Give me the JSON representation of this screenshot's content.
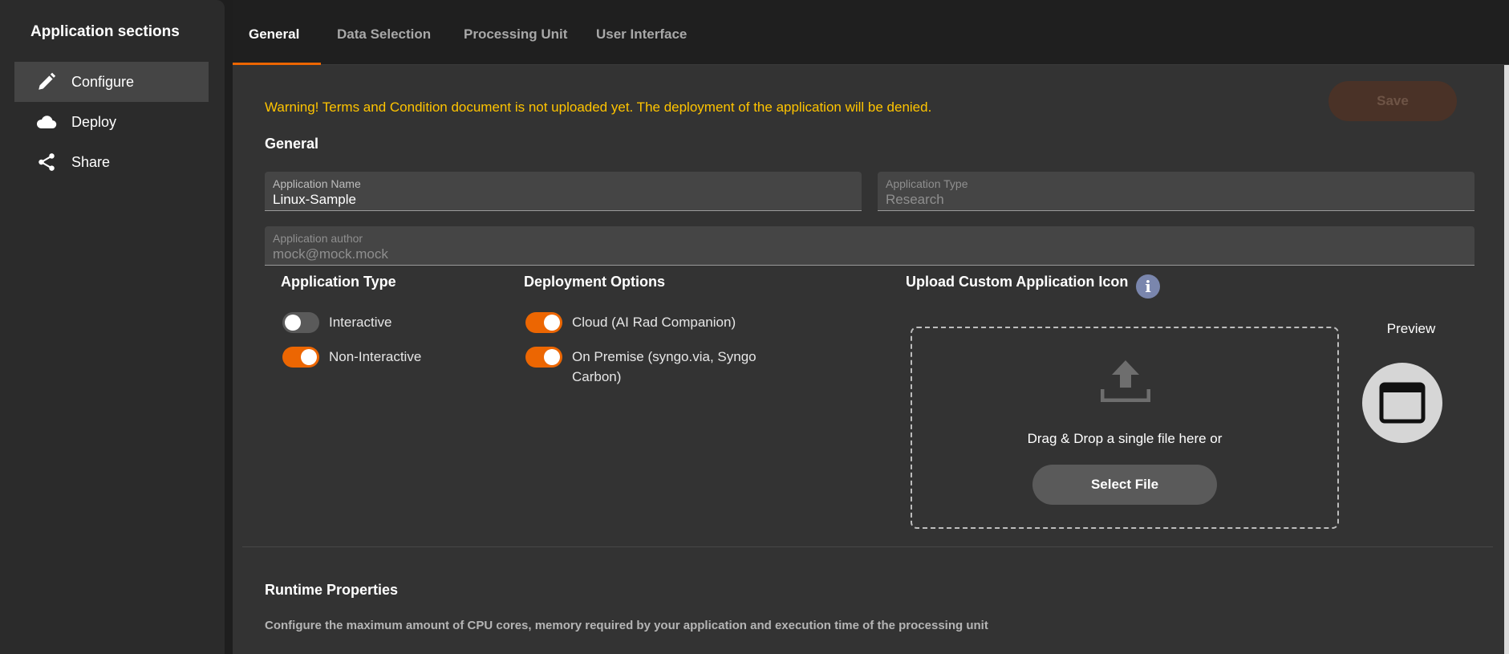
{
  "sidebar": {
    "title": "Application sections",
    "items": [
      {
        "label": "Configure",
        "icon": "pencil-icon",
        "active": true
      },
      {
        "label": "Deploy",
        "icon": "cloud-icon",
        "active": false
      },
      {
        "label": "Share",
        "icon": "share-icon",
        "active": false
      }
    ]
  },
  "tabs": [
    {
      "label": "General",
      "active": true
    },
    {
      "label": "Data Selection",
      "active": false
    },
    {
      "label": "Processing Unit",
      "active": false
    },
    {
      "label": "User Interface",
      "active": false
    }
  ],
  "warning": "Warning! Terms and Condition document is not uploaded yet. The deployment of the application will be denied.",
  "save_label": "Save",
  "general": {
    "title": "General",
    "app_name": {
      "label": "Application Name",
      "value": "Linux-Sample"
    },
    "app_type_field": {
      "label": "Application Type",
      "value": "Research"
    },
    "author": {
      "label": "Application author",
      "value": "mock@mock.mock"
    }
  },
  "application_type": {
    "title": "Application Type",
    "options": [
      {
        "label": "Interactive",
        "on": false
      },
      {
        "label": "Non-Interactive",
        "on": true
      }
    ]
  },
  "deployment": {
    "title": "Deployment Options",
    "options": [
      {
        "label": "Cloud (AI Rad Companion)",
        "on": true
      },
      {
        "label": "On Premise (syngo.via, Syngo Carbon)",
        "on": true
      }
    ]
  },
  "upload": {
    "title": "Upload Custom Application Icon",
    "info_icon": "info-icon",
    "dropzone_text": "Drag & Drop a single file here or",
    "select_label": "Select File",
    "preview_label": "Preview"
  },
  "runtime": {
    "title": "Runtime Properties",
    "description": "Configure the maximum amount of CPU cores, memory required by your application and execution time of the processing unit"
  },
  "colors": {
    "accent": "#ec6602",
    "warning": "#ffc400",
    "background": "#333333"
  }
}
